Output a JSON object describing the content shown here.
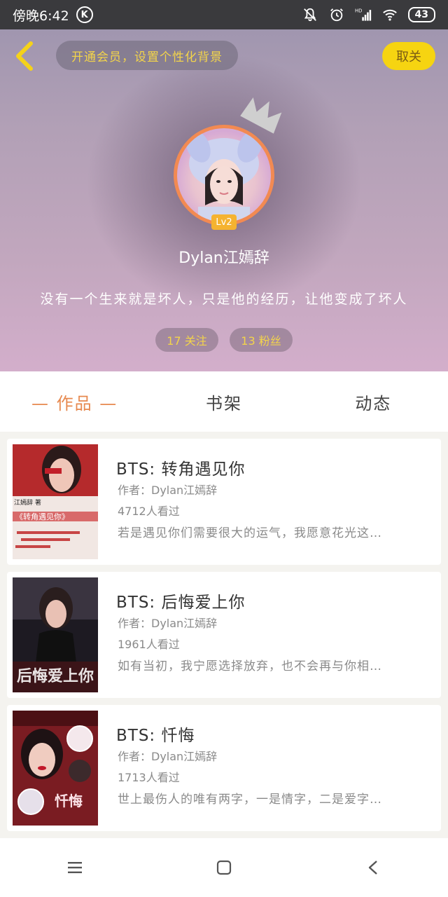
{
  "status_bar": {
    "time": "傍晚6:42",
    "k_badge": "K",
    "battery": "43",
    "icons": [
      "bell-mute-icon",
      "alarm-icon",
      "hd-signal-icon",
      "wifi-icon",
      "battery-icon"
    ]
  },
  "header": {
    "member_promo": "开通会员，设置个性化背景",
    "follow_label": "取关"
  },
  "profile": {
    "level": "Lv2",
    "username": "Dylan江嫣辞",
    "bio": "没有一个生来就是坏人，只是他的经历，让他变成了坏人",
    "following": "17 关注",
    "followers": "13 粉丝"
  },
  "tabs": [
    {
      "label": "— 作品 —",
      "active": true
    },
    {
      "label": "书架",
      "active": false
    },
    {
      "label": "动态",
      "active": false
    }
  ],
  "books": [
    {
      "title": "BTS: 转角遇见你",
      "author": "作者：Dylan江嫣辞",
      "reads": "4712人看过",
      "desc": "若是遇见你们需要很大的运气，我愿意花光这…",
      "cover_text_1": "江嫣辞 著",
      "cover_text_2": "《转角遇见你》"
    },
    {
      "title": "BTS: 后悔爱上你",
      "author": "作者：Dylan江嫣辞",
      "reads": "1961人看过",
      "desc": "如有当初，我宁愿选择放弃，也不会再与你相…",
      "cover_text_1": "后悔爱上你"
    },
    {
      "title": "BTS: 忏悔",
      "author": "作者：Dylan江嫣辞",
      "reads": "1713人看过",
      "desc": "世上最伤人的唯有两字，一是情字，二是爱字…",
      "cover_text_1": "忏悔"
    }
  ],
  "colors": {
    "accent_orange": "#e7894f",
    "follow_yellow": "#f6d411",
    "promo_text": "#f3d44a",
    "level_badge": "#f5b330"
  },
  "navbar": [
    "menu-icon",
    "home-square-icon",
    "back-triangle-icon"
  ]
}
